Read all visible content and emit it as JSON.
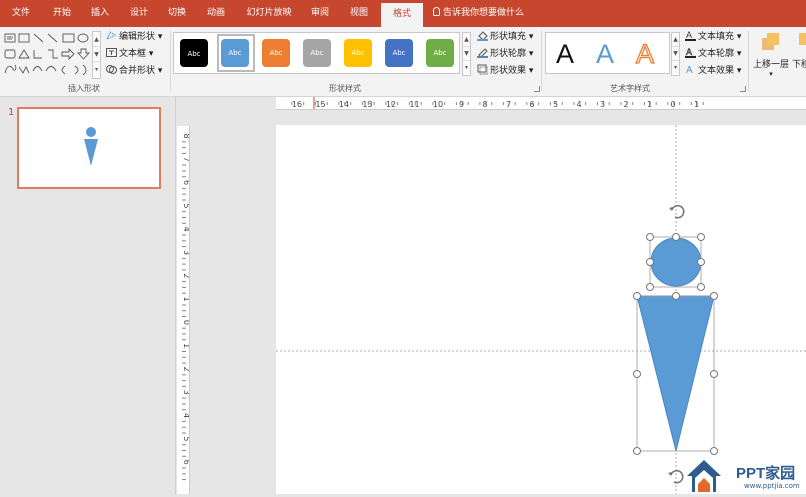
{
  "tabs": [
    {
      "label": "文件",
      "name": "tab-file"
    },
    {
      "label": "开始",
      "name": "tab-home"
    },
    {
      "label": "插入",
      "name": "tab-insert"
    },
    {
      "label": "设计",
      "name": "tab-design"
    },
    {
      "label": "切换",
      "name": "tab-transitions"
    },
    {
      "label": "动画",
      "name": "tab-animations"
    },
    {
      "label": "幻灯片放映",
      "name": "tab-slideshow"
    },
    {
      "label": "审阅",
      "name": "tab-review"
    },
    {
      "label": "视图",
      "name": "tab-view"
    },
    {
      "label": "格式",
      "name": "tab-format",
      "active": true
    }
  ],
  "tellme": "告诉我你想要做什么",
  "ribbon": {
    "insert_shapes": {
      "group_label": "插入形状",
      "edit_shape": "编辑形状",
      "text_box": "文本框",
      "merge_shapes": "合并形状"
    },
    "shape_styles": {
      "group_label": "形状样式",
      "swatch_text": "Abc",
      "swatches": [
        "#000000",
        "#5b9bd5",
        "#ed7d31",
        "#a5a5a5",
        "#ffc000",
        "#4472c4",
        "#70ad47"
      ],
      "shape_fill": "形状填充",
      "shape_outline": "形状轮廓",
      "shape_effects": "形状效果"
    },
    "wordart_styles": {
      "group_label": "艺术字样式",
      "letter": "A",
      "text_fill": "文本填充",
      "text_outline": "文本轮廓",
      "text_effects": "文本效果"
    },
    "arrange": {
      "bring_forward": "上移一层",
      "send_backward": "下移"
    }
  },
  "thumbnails": {
    "slide_number": "1"
  },
  "rulers": {
    "horizontal_ticks": [
      "16",
      "15",
      "14",
      "13",
      "12",
      "11",
      "10",
      "9",
      "8",
      "7",
      "6",
      "5",
      "4",
      "3",
      "2",
      "1",
      "0",
      "1"
    ],
    "vertical_ticks": [
      "8",
      "7",
      "6",
      "5",
      "4",
      "3",
      "2",
      "1",
      "0",
      "1",
      "2",
      "3",
      "4",
      "5",
      "6"
    ]
  },
  "colors": {
    "accent": "#c6472e",
    "shape_fill": "#5b9bd5",
    "shape_stroke": "#4a86c0"
  },
  "watermark": {
    "title": "PPT家园",
    "url": "www.pptjia.com"
  }
}
